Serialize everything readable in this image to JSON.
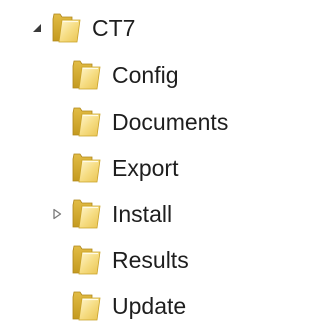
{
  "tree": {
    "root": {
      "label": "CT7",
      "expanded": true,
      "toggle_icon": "expanded-triangle-icon"
    },
    "children": [
      {
        "label": "Config",
        "has_children": false
      },
      {
        "label": "Documents",
        "has_children": false
      },
      {
        "label": "Export",
        "has_children": false
      },
      {
        "label": "Install",
        "has_children": true,
        "toggle_icon": "collapsed-triangle-icon"
      },
      {
        "label": "Results",
        "has_children": false
      },
      {
        "label": "Update",
        "has_children": false
      }
    ]
  },
  "colors": {
    "folder_back": "#c9a227",
    "folder_front": "#f3d97a",
    "folder_light": "#fdf3c4",
    "toggle_expanded": "#3a3a3a",
    "toggle_collapsed": "#7a7a7a",
    "text": "#1e1e1e"
  }
}
